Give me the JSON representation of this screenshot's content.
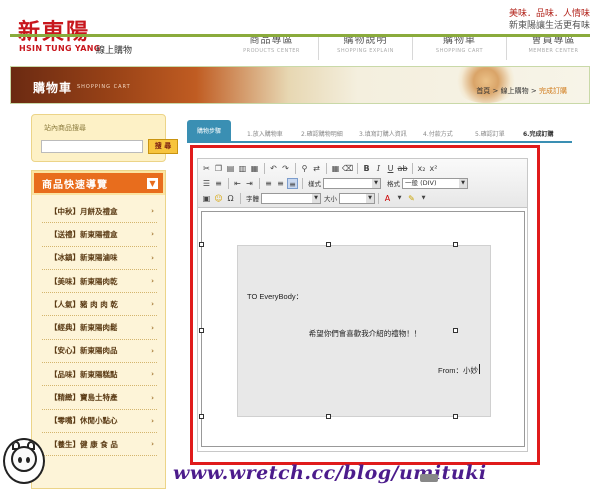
{
  "header": {
    "logo_cn": "新東陽",
    "logo_en": "HSIN TUNG YANG",
    "logo_sub": "線上購物",
    "slogan_line1": "美味．品味．人情味",
    "slogan_line2": "新東陽讓生活更有味",
    "nav": [
      {
        "label": "商品專區",
        "sub": "PRODUCTS CENTER"
      },
      {
        "label": "購物說明",
        "sub": "SHOPPING EXPLAIN"
      },
      {
        "label": "購物車",
        "sub": "SHOPPING CART"
      },
      {
        "label": "會員專區",
        "sub": "MEMBER CENTER"
      }
    ]
  },
  "banner": {
    "title": "購物車",
    "title_en": "SHOPPING CART",
    "breadcrumb": {
      "home": "首頁",
      "sep": ">",
      "section": "線上購物",
      "current": "完成訂購"
    }
  },
  "search": {
    "label": "站內商品搜尋",
    "placeholder": "",
    "button": "搜 尋"
  },
  "quick_nav": {
    "title": "商品快速導覽",
    "items": [
      "【中秋】月餅及禮盒",
      "【送禮】新東陽禮盒",
      "【冰鎮】新東陽滷味",
      "【美味】新東陽肉乾",
      "【人氣】豬 肉 肉 乾",
      "【經典】新東陽肉鬆",
      "【安心】新東陽肉品",
      "【品味】新東陽糕點",
      "【精緻】寶島土特產",
      "【零嘴】休閒小點心",
      "【養生】健 康 食 品"
    ]
  },
  "steps": [
    {
      "label": "購物步驟",
      "state": "active"
    },
    {
      "label": "1.放入購物車",
      "state": "normal"
    },
    {
      "label": "2.確認購物明細",
      "state": "normal"
    },
    {
      "label": "3.填寫訂購人資訊",
      "state": "normal"
    },
    {
      "label": "4.付款方式",
      "state": "normal"
    },
    {
      "label": "5.確認訂單",
      "state": "normal"
    },
    {
      "label": "6.完成訂購",
      "state": "done"
    }
  ],
  "editor": {
    "format_label": "樣式",
    "paragraph_label": "格式",
    "paragraph_value": "一般 (DIV)",
    "font_label": "字體",
    "size_label": "大小",
    "icons": {
      "row1": [
        "cut-icon",
        "copy-icon",
        "paste-icon",
        "paste-text-icon",
        "paste-word-icon",
        "undo-icon",
        "redo-icon",
        "find-icon",
        "replace-icon",
        "table-icon",
        "clear-format-icon",
        "bold-icon",
        "italic-icon",
        "underline-icon",
        "strike-icon",
        "subscript-icon",
        "superscript-icon"
      ],
      "row2": [
        "numbered-list-icon",
        "bullet-list-icon",
        "outdent-icon",
        "indent-icon",
        "align-left-icon",
        "align-center-icon",
        "align-right-icon"
      ],
      "row3": [
        "image-icon",
        "smiley-icon",
        "special-char-icon",
        "text-color-icon",
        "bg-color-icon"
      ]
    },
    "letter": {
      "greeting": "TO EveryBody：",
      "body": "希望你們會喜歡我介紹的禮物！！",
      "from": "From：小妙"
    }
  },
  "footer": {
    "watermark": "www.wretch.cc/blog/umituki"
  },
  "colors": {
    "brand_red": "#c8161d",
    "tab_blue": "#3a8fb3",
    "highlight_red": "#e01b1b",
    "quick_orange": "#e86d1d",
    "breadcrumb_current": "#d07a19",
    "watermark_purple": "#4c1c8c"
  }
}
